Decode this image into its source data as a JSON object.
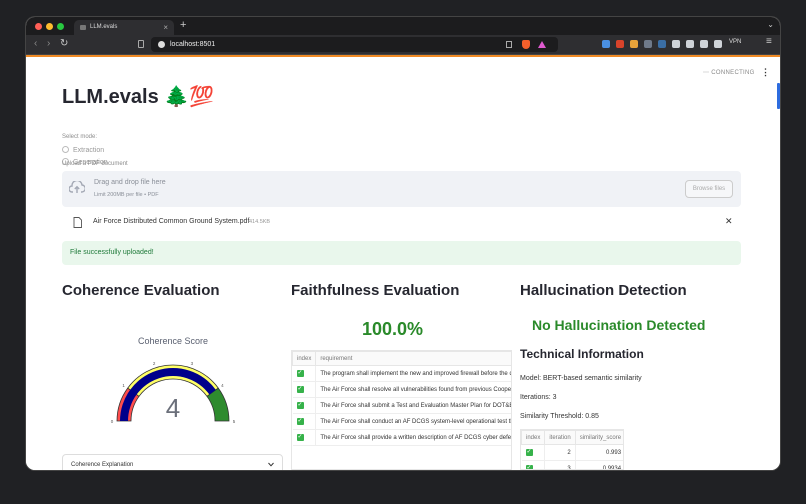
{
  "browser": {
    "tab_title": "LLM.evals",
    "tab_close": "×",
    "new_tab": "+",
    "tab_menu": "⌄",
    "url": "localhost:8501",
    "vpn_label": "VPN",
    "nav_back": "‹",
    "nav_forward": "›",
    "nav_reload": "↻"
  },
  "app": {
    "status": "CONNECTING",
    "title": "LLM.evals 🌲💯",
    "mode_label": "Select mode:",
    "modes": [
      "Extraction",
      "Generation"
    ],
    "upload_label": "Upload a PDF document",
    "dropzone_text": "Drag and drop file here",
    "dropzone_limit": "Limit 200MB per file • PDF",
    "browse_label": "Browse files",
    "file_name": "Air Force Distributed Common Ground System.pdf",
    "file_size": "414.5KB",
    "file_remove": "✕",
    "success_msg": "File successfully uploaded!"
  },
  "coherence": {
    "heading": "Coherence Evaluation",
    "gauge_title": "Coherence Score",
    "value": 4,
    "value_text": "4",
    "range": [
      0,
      5
    ],
    "ticks": [
      "0",
      "1",
      "2",
      "3",
      "4",
      "5"
    ],
    "expander_label": "Coherence Explanation",
    "colors": {
      "bar": "#00008b",
      "band_low": "#ff4d4d",
      "band_mid": "#ffff66",
      "band_high": "#2e8b2e"
    }
  },
  "faithfulness": {
    "heading": "Faithfulness Evaluation",
    "score": "100.0%",
    "columns": [
      "index",
      "requirement"
    ],
    "rows": [
      "The program shall implement the new and improved firewall before the deadline",
      "The Air Force shall resolve all vulnerabilities found from previous Cooperative",
      "The Air Force shall submit a Test and Evaluation Master Plan for DOT&E approval",
      "The Air Force shall conduct an AF DCGS system-level operational test that",
      "The Air Force shall provide a written description of AF DCGS cyber defense"
    ]
  },
  "hallucination": {
    "heading": "Hallucination Detection",
    "result": "No Hallucination Detected",
    "tech_heading": "Technical Information",
    "model": "Model: BERT-based semantic similarity",
    "iterations": "Iterations: 3",
    "threshold": "Similarity Threshold: 0.85",
    "columns": [
      "index",
      "iteration",
      "similarity_score"
    ],
    "rows": [
      {
        "iteration": "2",
        "score": "0.993"
      },
      {
        "iteration": "3",
        "score": "0.9934"
      }
    ]
  },
  "icon_names": [
    "upload-cloud-icon",
    "file-icon",
    "close-icon",
    "kebab-menu-icon",
    "chevron-down-icon",
    "check-icon"
  ]
}
